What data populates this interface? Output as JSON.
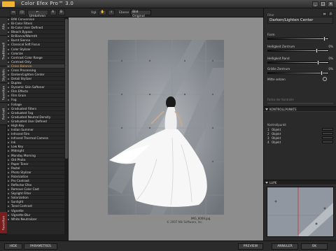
{
  "window": {
    "title": "Color Efex Pro™ 3.0"
  },
  "toolbar": {
    "compare_label": "",
    "split_label": "",
    "view_label": "← Umkehren",
    "btn_a": "A",
    "btn_b": "B",
    "zoom_label": "Vgl.",
    "mode_label": "Ebene",
    "mode_value": "Bild Original"
  },
  "tabs": [
    {
      "label": "Alle"
    },
    {
      "label": "Traditionell"
    },
    {
      "label": "Stylistic"
    },
    {
      "label": "Favoriten"
    },
    {
      "label": "Portrait"
    },
    {
      "label": "Favoriten"
    }
  ],
  "filters": {
    "selected_index": 11,
    "items": [
      "B/W Conversion",
      "Bi-Color Filters",
      "Bi-Color User Defined",
      "Bleach Bypass",
      "Brilliance/Warmth",
      "Burnt Sienna",
      "Classical Soft Focus",
      "Color Stylizer",
      "Colorize",
      "Contrast Color Range",
      "Contrast Only",
      "Cross Balance",
      "Cross Processing",
      "Darken/Lighten Center",
      "Detail Stylizer",
      "Duplex",
      "Dynamic Skin Softener",
      "Film Effects",
      "Film Grain",
      "Fog",
      "Foliage",
      "Graduated Filters",
      "Graduated Fog",
      "Graduated Neutral Density",
      "Graduated User Defined",
      "High Key",
      "Indian Summer",
      "Infrared Film",
      "Infrared Thermal Camera",
      "Ink",
      "Low Key",
      "Midnight",
      "Monday Morning",
      "Old Photo",
      "Paper Toner",
      "Pastel",
      "Photo Stylizer",
      "Polarization",
      "Pro Contrast",
      "Reflector Efex",
      "Remove Color Cast",
      "Skylight Filter",
      "Solarization",
      "Sunlight",
      "Tonal Contrast",
      "Vignette",
      "Vignette Blur",
      "White Neutralizer"
    ]
  },
  "preview": {
    "caption1": "IMG_6069.jpg",
    "caption2": "© 2007 Nik Software, Inc."
  },
  "panel": {
    "head_label": "Filter",
    "filter_name": "Darken/Lighten Center",
    "sliders": [
      {
        "label": "Form",
        "value": "",
        "pos": 0.92
      },
      {
        "label": "Helligkeit Zentrum",
        "value": "0%",
        "pos": 0.8
      },
      {
        "label": "Helligkeit Rand",
        "value": "0%",
        "pos": 0.82
      },
      {
        "label": "Größe Zentrum",
        "value": "0%",
        "pos": 0.88
      }
    ],
    "center_label": "Mitte setzen",
    "dim_label": "Farbe der Kontrolle",
    "section_cp": "KONTROLLPUNKTE",
    "cp_header": "Kontrollpunkt",
    "cp_rows": [
      {
        "num": "1",
        "name": "Objekt"
      },
      {
        "num": "2",
        "name": "Objekt"
      },
      {
        "num": "3",
        "name": "Objekt"
      },
      {
        "num": "4",
        "name": "Objekt"
      }
    ],
    "section_loupe": "LUPE"
  },
  "bottom": {
    "hide_label": "HIDE",
    "params_label": "PARAMETRES",
    "preview_label": "PREVIEW",
    "cancel_label": "ANNULER",
    "ok_label": "OK"
  }
}
